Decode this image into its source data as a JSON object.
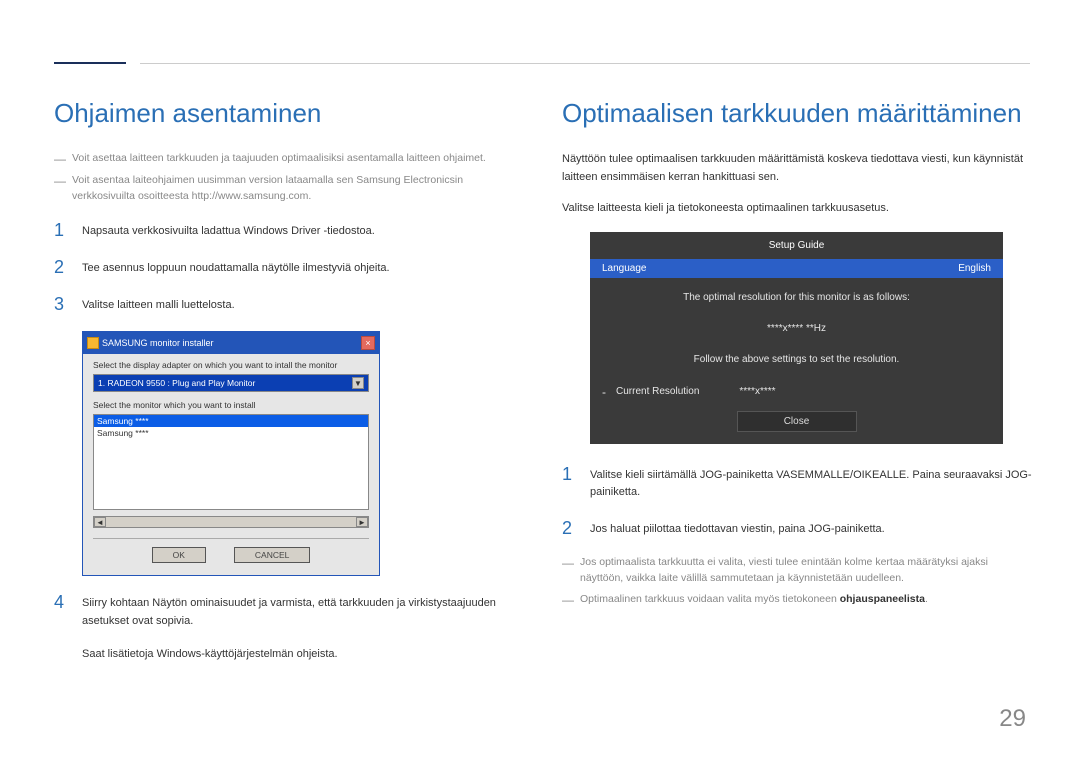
{
  "page_number": "29",
  "left": {
    "heading": "Ohjaimen asentaminen",
    "note1": "Voit asettaa laitteen tarkkuuden ja taajuuden optimaalisiksi asentamalla laitteen ohjaimet.",
    "note2": "Voit asentaa laiteohjaimen uusimman version lataamalla sen Samsung Electronicsin verkkosivuilta osoitteesta http://www.samsung.com.",
    "step1": "Napsauta verkkosivuilta ladattua Windows Driver -tiedostoa.",
    "step2": "Tee asennus loppuun noudattamalla näytölle ilmestyviä ohjeita.",
    "step3": "Valitse laitteen malli luettelosta.",
    "installer": {
      "window_title": "SAMSUNG monitor installer",
      "label1": "Select the display adapter on which you want to intall the monitor",
      "select_value": "1. RADEON 9550 : Plug and Play Monitor",
      "label2": "Select the monitor which you want to install",
      "list_item1": "Samsung ****",
      "list_item2": "Samsung ****",
      "btn_ok": "OK",
      "btn_cancel": "CANCEL"
    },
    "step4": "Siirry kohtaan Näytön ominaisuudet ja varmista, että tarkkuuden ja virkistystaajuuden asetukset ovat sopivia.",
    "step4_sub": "Saat lisätietoja Windows-käyttöjärjestelmän ohjeista."
  },
  "right": {
    "heading": "Optimaalisen tarkkuuden määrittäminen",
    "para1": "Näyttöön tulee optimaalisen tarkkuuden määrittämistä koskeva tiedottava viesti, kun käynnistät laitteen ensimmäisen kerran hankittuasi sen.",
    "para2": "Valitse laitteesta kieli ja tietokoneesta optimaalinen tarkkuusasetus.",
    "osd": {
      "title": "Setup Guide",
      "language_label": "Language",
      "language_value": "English",
      "msg1": "The optimal resolution for this monitor is as follows:",
      "msg2": "****x**** **Hz",
      "msg3": "Follow the above settings to set the resolution.",
      "current_label": "Current Resolution",
      "current_value": "****x****",
      "close": "Close"
    },
    "step1": "Valitse kieli siirtämällä JOG-painiketta VASEMMALLE/OIKEALLE. Paina seuraavaksi JOG-painiketta.",
    "step2": "Jos haluat piilottaa tiedottavan viestin, paina JOG-painiketta.",
    "note1": "Jos optimaalista tarkkuutta ei valita, viesti tulee enintään kolme kertaa määrätyksi ajaksi näyttöön, vaikka laite välillä sammutetaan ja käynnistetään uudelleen.",
    "note2_prefix": "Optimaalinen tarkkuus voidaan valita myös tietokoneen ",
    "note2_strong": "ohjauspaneelista",
    "note2_suffix": "."
  }
}
